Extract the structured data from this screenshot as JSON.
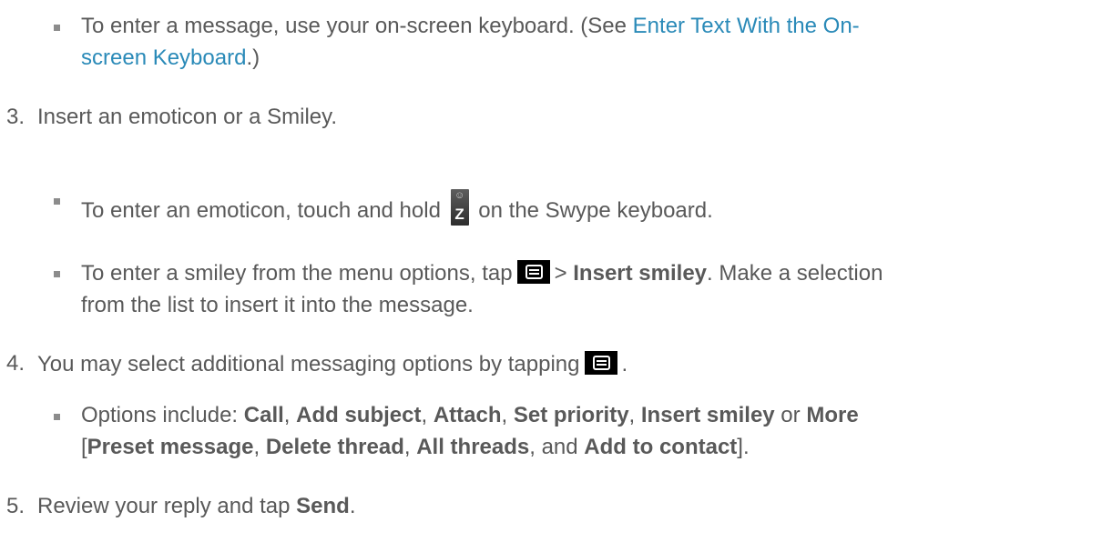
{
  "bullets": {
    "b1": {
      "pre": "To enter a message, use your on-screen keyboard. (See ",
      "link_a": "Enter Text With the On-",
      "link_b": "screen Keyboard",
      "post": ".)"
    },
    "b2": {
      "pre": "To enter an emoticon, touch and hold",
      "post": "on the Swype keyboard."
    },
    "b3": {
      "pre": "To enter a smiley from the menu options, tap",
      "gt": ">",
      "bold": "Insert smiley",
      "post": ". Make a selection",
      "line2": "from the list to insert it into the message."
    },
    "b4": {
      "pre": "Options include: ",
      "call": "Call",
      "add_subject": "Add subject",
      "attach": "Attach",
      "set_priority": "Set priority",
      "insert_smiley": "Insert smiley",
      "or": " or ",
      "more": "More",
      "lbracket": "[",
      "preset_message": "Preset message",
      "delete_thread": "Delete thread",
      "all_threads": "All threads",
      "and": ", and ",
      "add_to_contact": "Add to contact",
      "end": "].",
      "comma": ", "
    }
  },
  "steps": {
    "s3": {
      "num": "3.",
      "text": "Insert an emoticon or a Smiley."
    },
    "s4": {
      "num": "4.",
      "text": "You may select additional messaging options by tapping",
      "end": "."
    },
    "s5": {
      "num": "5.",
      "pre": "Review your reply and tap ",
      "bold": "Send",
      "end": "."
    }
  },
  "keys": {
    "z_letter": "Z",
    "z_smile": "☺",
    "z_icon": "swype-z-key-icon",
    "menu_icon": "menu-key-icon"
  }
}
